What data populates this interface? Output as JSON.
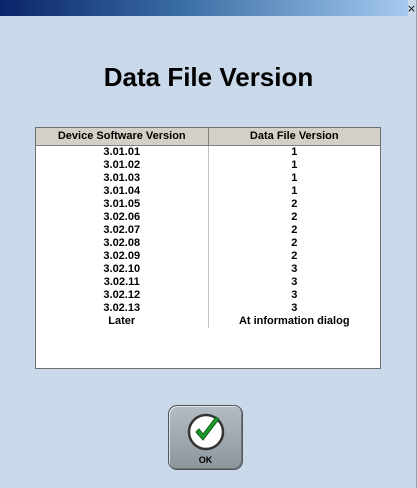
{
  "window": {
    "close_label": "×"
  },
  "title": "Data File Version",
  "table": {
    "headers": [
      "Device Software Version",
      "Data File Version"
    ],
    "rows": [
      [
        "3.01.01",
        "1"
      ],
      [
        "3.01.02",
        "1"
      ],
      [
        "3.01.03",
        "1"
      ],
      [
        "3.01.04",
        "1"
      ],
      [
        "3.01.05",
        "2"
      ],
      [
        "3.02.06",
        "2"
      ],
      [
        "3.02.07",
        "2"
      ],
      [
        "3.02.08",
        "2"
      ],
      [
        "3.02.09",
        "2"
      ],
      [
        "3.02.10",
        "3"
      ],
      [
        "3.02.11",
        "3"
      ],
      [
        "3.02.12",
        "3"
      ],
      [
        "3.02.13",
        "3"
      ],
      [
        "Later",
        "At information dialog"
      ]
    ]
  },
  "ok_button": {
    "label": "OK",
    "icon": "checkmark-icon"
  },
  "colors": {
    "background": "#c9d9ea",
    "check_green": "#1e9a2a"
  }
}
